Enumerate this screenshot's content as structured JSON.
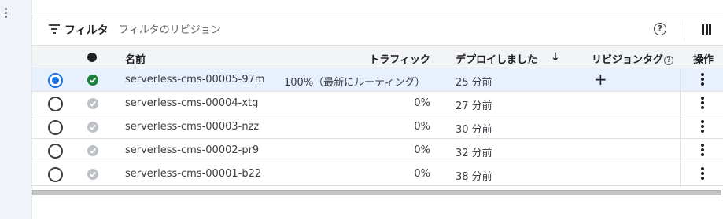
{
  "toolbar": {
    "filter_label": "フィルタ",
    "filter_placeholder": "フィルタのリビジョン",
    "help_icon_glyph": "?"
  },
  "table": {
    "columns": {
      "name": "名前",
      "traffic": "トラフィック",
      "deployed": "デプロイしました",
      "sort_arrow": "↓",
      "tags": "リビジョンタグ",
      "tags_help_glyph": "?",
      "actions": "操作"
    },
    "add_tag_glyph": "+",
    "rows": [
      {
        "name": "serverless-cms-00005-97m",
        "traffic": "100%（最新にルーティング）",
        "deployed": "25 分前",
        "selected": true,
        "status": "ready"
      },
      {
        "name": "serverless-cms-00004-xtg",
        "traffic": "0%",
        "deployed": "27 分前",
        "selected": false,
        "status": "inactive"
      },
      {
        "name": "serverless-cms-00003-nzz",
        "traffic": "0%",
        "deployed": "30 分前",
        "selected": false,
        "status": "inactive"
      },
      {
        "name": "serverless-cms-00002-pr9",
        "traffic": "0%",
        "deployed": "32 分前",
        "selected": false,
        "status": "inactive"
      },
      {
        "name": "serverless-cms-00001-b22",
        "traffic": "0%",
        "deployed": "38 分前",
        "selected": false,
        "status": "inactive"
      }
    ]
  },
  "colors": {
    "accent": "#1a73e8",
    "ready": "#188038",
    "inactive": "#bdc1c6",
    "selected_row": "#e8f0fe"
  }
}
